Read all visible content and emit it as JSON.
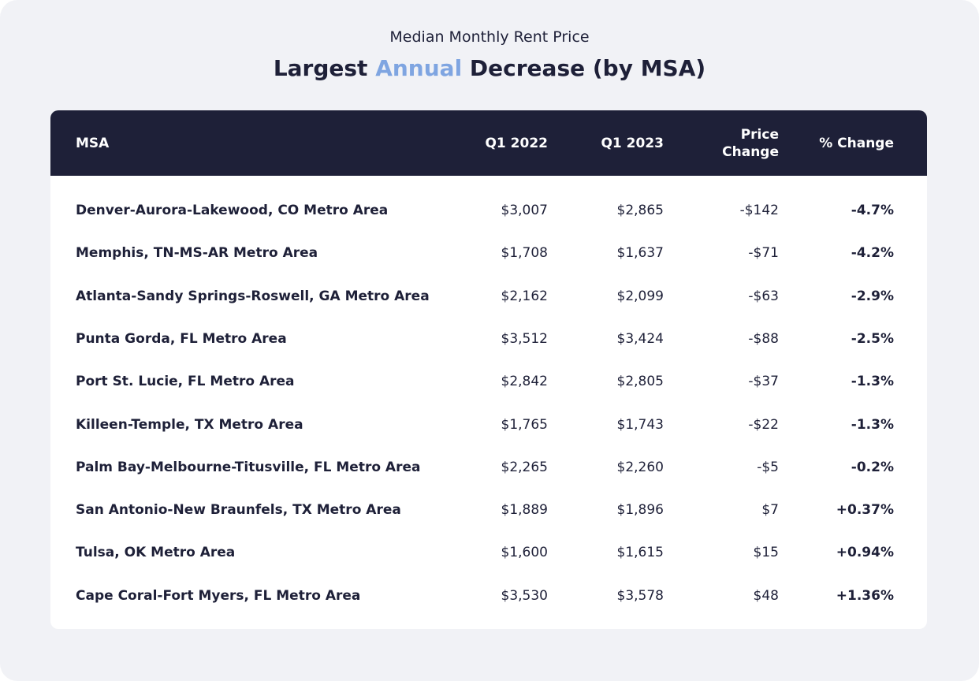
{
  "subtitle": "Median Monthly Rent Price",
  "title": {
    "pre": "Largest ",
    "highlight": "Annual",
    "post": " Decrease (by MSA)"
  },
  "colors": {
    "header_bg": "#1e2038",
    "highlight": "#7fa5e1",
    "background": "#f1f2f6"
  },
  "chart_data": {
    "type": "table",
    "columns": [
      "MSA",
      "Q1 2022",
      "Q1 2023",
      "Price Change",
      "% Change"
    ],
    "rows": [
      [
        "Denver-Aurora-Lakewood, CO Metro Area",
        "$3,007",
        "$2,865",
        "-$142",
        "-4.7%"
      ],
      [
        "Memphis, TN-MS-AR Metro Area",
        "$1,708",
        "$1,637",
        "-$71",
        "-4.2%"
      ],
      [
        "Atlanta-Sandy Springs-Roswell, GA Metro Area",
        "$2,162",
        "$2,099",
        "-$63",
        "-2.9%"
      ],
      [
        "Punta Gorda, FL Metro Area",
        "$3,512",
        "$3,424",
        "-$88",
        "-2.5%"
      ],
      [
        "Port St. Lucie, FL Metro Area",
        "$2,842",
        "$2,805",
        "-$37",
        "-1.3%"
      ],
      [
        "Killeen-Temple, TX Metro Area",
        "$1,765",
        "$1,743",
        "-$22",
        "-1.3%"
      ],
      [
        "Palm Bay-Melbourne-Titusville, FL Metro Area",
        "$2,265",
        "$2,260",
        "-$5",
        "-0.2%"
      ],
      [
        "San Antonio-New Braunfels, TX Metro Area",
        "$1,889",
        "$1,896",
        "$7",
        "+0.37%"
      ],
      [
        "Tulsa, OK Metro Area",
        "$1,600",
        "$1,615",
        "$15",
        "+0.94%"
      ],
      [
        "Cape Coral-Fort Myers, FL Metro Area",
        "$3,530",
        "$3,578",
        "$48",
        "+1.36%"
      ]
    ]
  }
}
